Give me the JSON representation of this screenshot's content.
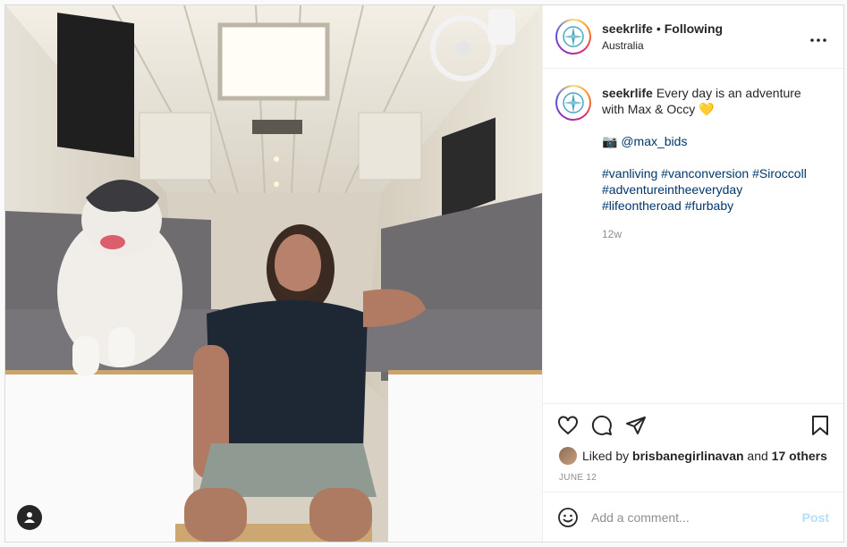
{
  "header": {
    "username": "seekrlife",
    "separator": "•",
    "follow_status": "Following",
    "location": "Australia",
    "more_icon": "more-horizontal-icon"
  },
  "caption": {
    "username": "seekrlife",
    "text": "Every day is an adventure with Max & Occy",
    "emoji": "💛",
    "camera_emoji": "📷",
    "mention": "@max_bids",
    "hashtags": [
      "#vanliving",
      "#vanconversion",
      "#Siroccoll",
      "#adventureintheeveryday",
      "#lifeontheroad",
      "#furbaby"
    ],
    "time": "12w"
  },
  "actions": {
    "like_icon": "heart-icon",
    "comment_icon": "comment-icon",
    "share_icon": "share-icon",
    "save_icon": "bookmark-icon"
  },
  "likes": {
    "prefix": "Liked by",
    "user": "brisbanegirlinavan",
    "middle": "and",
    "others": "17 others"
  },
  "date": "JUNE 12",
  "comment": {
    "emoji_icon": "smiley-icon",
    "placeholder": "Add a comment...",
    "post_label": "Post"
  },
  "photo": {
    "tag_icon": "user-tag-icon"
  },
  "colors": {
    "link": "#00376b",
    "muted": "#8e8e8e",
    "post_disabled": "#b2dffc",
    "border": "#dbdbdb"
  }
}
